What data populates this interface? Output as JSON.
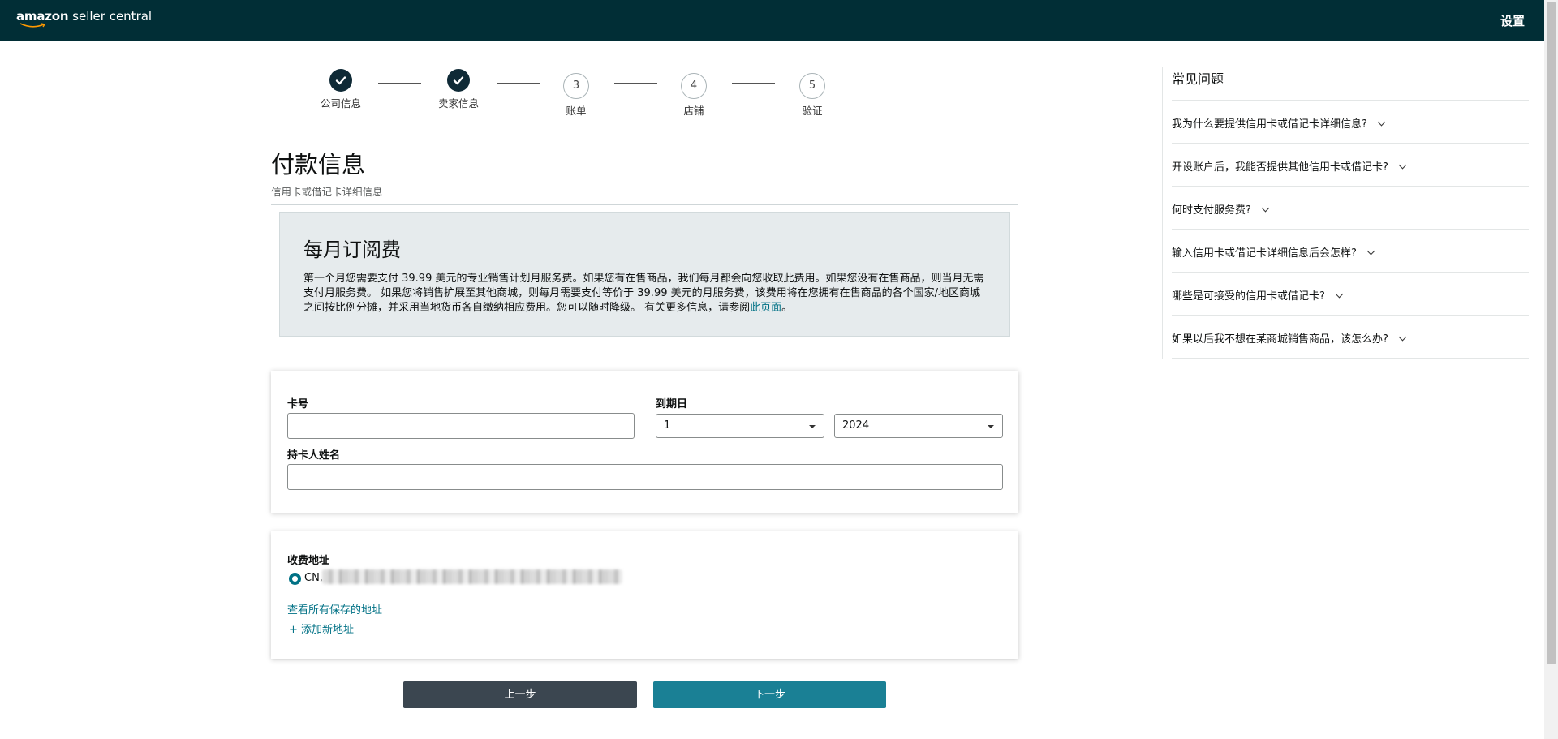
{
  "header": {
    "logo_brand": "amazon",
    "logo_suffix": " seller central",
    "settings_label": "设置"
  },
  "steps": [
    {
      "label": "公司信息",
      "status": "complete",
      "number": ""
    },
    {
      "label": "卖家信息",
      "status": "complete",
      "number": ""
    },
    {
      "label": "账单",
      "status": "pending",
      "number": "3"
    },
    {
      "label": "店铺",
      "status": "pending",
      "number": "4"
    },
    {
      "label": "验证",
      "status": "pending",
      "number": "5"
    }
  ],
  "page": {
    "title": "付款信息",
    "subtitle": "信用卡或借记卡详细信息"
  },
  "fee": {
    "title": "每月订阅费",
    "text": "第一个月您需要支付 39.99 美元的专业销售计划月服务费。如果您有在售商品，我们每月都会向您收取此费用。如果您没有在售商品，则当月无需支付月服务费。 如果您将销售扩展至其他商城，则每月需要支付等价于 39.99 美元的月服务费，该费用将在您拥有在售商品的各个国家/地区商城之间按比例分摊，并采用当地货币各自缴纳相应费用。您可以随时降级。 有关更多信息，请参阅",
    "link_text": "此页面",
    "text_end": "。"
  },
  "card_form": {
    "card_number_label": "卡号",
    "card_number_value": "",
    "expiry_label": "到期日",
    "expiry_month": "1",
    "expiry_year": "2024",
    "holder_label": "持卡人姓名",
    "holder_value": ""
  },
  "billing": {
    "label": "收费地址",
    "address_prefix": "CN,",
    "view_saved": "查看所有保存的地址",
    "add_new": "+ 添加新地址"
  },
  "buttons": {
    "prev": "上一步",
    "next": "下一步"
  },
  "faq": {
    "title": "常见问题",
    "items": [
      "我为什么要提供信用卡或借记卡详细信息?",
      "开设账户后，我能否提供其他信用卡或借记卡?",
      "何时支付服务费?",
      "输入信用卡或借记卡详细信息后会怎样?",
      "哪些是可接受的信用卡或借记卡?",
      "如果以后我不想在某商城销售商品，该怎么办?"
    ]
  },
  "colors": {
    "header_bg": "#012e36",
    "link": "#007185",
    "primary_button": "#1a8095",
    "secondary_button": "#3b4650"
  }
}
